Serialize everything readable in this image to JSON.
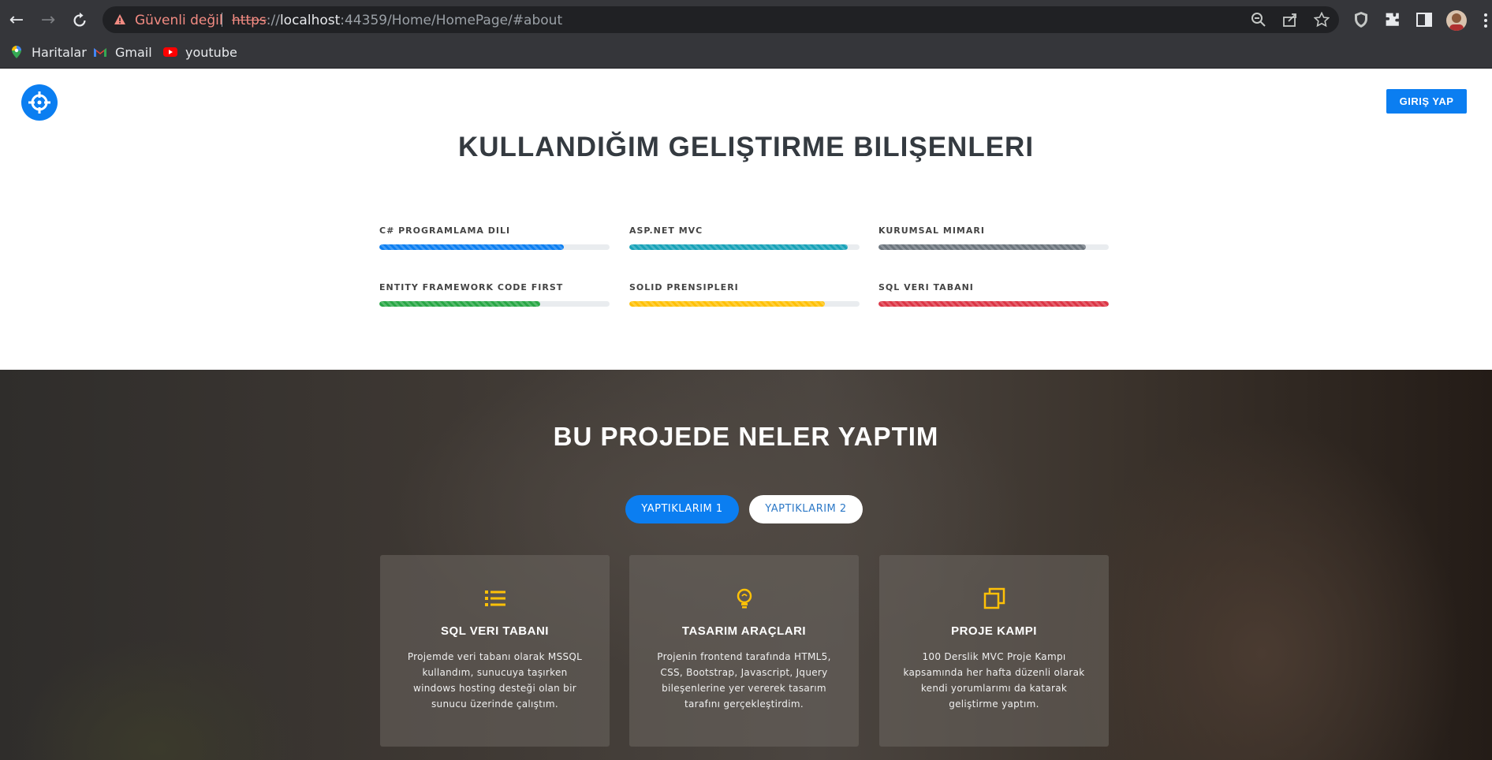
{
  "browser": {
    "security_label": "Güvenli değil",
    "url_scheme": "https",
    "url_sep": "://",
    "url_host": "localhost",
    "url_rest": ":44359/Home/HomePage/#about",
    "bookmarks": [
      {
        "label": "Haritalar",
        "icon": "maps-icon"
      },
      {
        "label": "Gmail",
        "icon": "gmail-icon"
      },
      {
        "label": "youtube",
        "icon": "youtube-icon"
      }
    ]
  },
  "header": {
    "login_label": "GIRIŞ YAP"
  },
  "skills": {
    "title": "KULLANDIĞIM GELIŞTIRME BILIŞENLERI",
    "items": [
      {
        "label": "C# PROGRAMLAMA DILI",
        "percent": 80,
        "color": "#0b7ef1"
      },
      {
        "label": "ASP.NET MVC",
        "percent": 95,
        "color": "#17a2b8"
      },
      {
        "label": "KURUMSAL MIMARI",
        "percent": 90,
        "color": "#6c757d"
      },
      {
        "label": "ENTITY FRAMEWORK CODE FIRST",
        "percent": 70,
        "color": "#28a745"
      },
      {
        "label": "SOLID PRENSIPLERI",
        "percent": 85,
        "color": "#ffc107"
      },
      {
        "label": "SQL VERI TABANI",
        "percent": 100,
        "color": "#dc3545"
      }
    ]
  },
  "projects": {
    "title": "BU PROJEDE NELER YAPTIM",
    "filters": [
      "YAPTIKLARIM 1",
      "YAPTIKLARIM 2"
    ],
    "accent_color": "#ffc107",
    "cards": [
      {
        "icon": "list-icon",
        "title": "SQL VERI TABANI",
        "text": "Projemde veri tabanı olarak MSSQL kullandım, sunucuya taşırken windows hosting desteği olan bir sunucu üzerinde çalıştım."
      },
      {
        "icon": "lightbulb-icon",
        "title": "TASARIM ARAÇLARI",
        "text": "Projenin frontend tarafında HTML5, CSS, Bootstrap, Javascript, Jquery bileşenlerine yer vererek tasarım tarafını gerçekleştirdim."
      },
      {
        "icon": "copy-icon",
        "title": "PROJE KAMPI",
        "text": "100 Derslik MVC Proje Kampı kapsamında her hafta düzenli olarak kendi yorumlarımı da katarak geliştirme yaptım."
      }
    ]
  }
}
